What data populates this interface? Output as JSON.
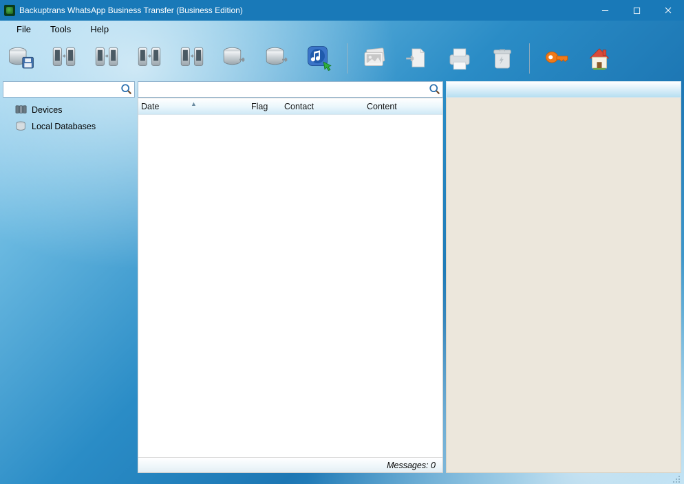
{
  "window": {
    "title": "Backuptrans WhatsApp Business Transfer (Business Edition)"
  },
  "menubar": {
    "file": "File",
    "tools": "Tools",
    "help": "Help"
  },
  "toolbar_icons": {
    "backup_db": "database-save",
    "transfer_p2p_1": "phone-transfer",
    "transfer_p2p_2": "phone-transfer",
    "transfer_p2p_3": "phone-transfer",
    "transfer_p2p_4": "phone-transfer",
    "db_export_1": "database-export",
    "db_export_2": "database-export",
    "itunes_import": "itunes-import",
    "media": "photo-stack",
    "export_file": "file-export",
    "print": "printer",
    "delete": "recycle-bin",
    "register": "key",
    "home": "home"
  },
  "sidebar": {
    "search_value": "",
    "items": [
      {
        "label": "Devices"
      },
      {
        "label": "Local Databases"
      }
    ]
  },
  "main": {
    "search_value": "",
    "columns": {
      "date": "Date",
      "flag": "Flag",
      "contact": "Contact",
      "content": "Content"
    },
    "rows": [],
    "status_label": "Messages:",
    "status_count": "0"
  }
}
